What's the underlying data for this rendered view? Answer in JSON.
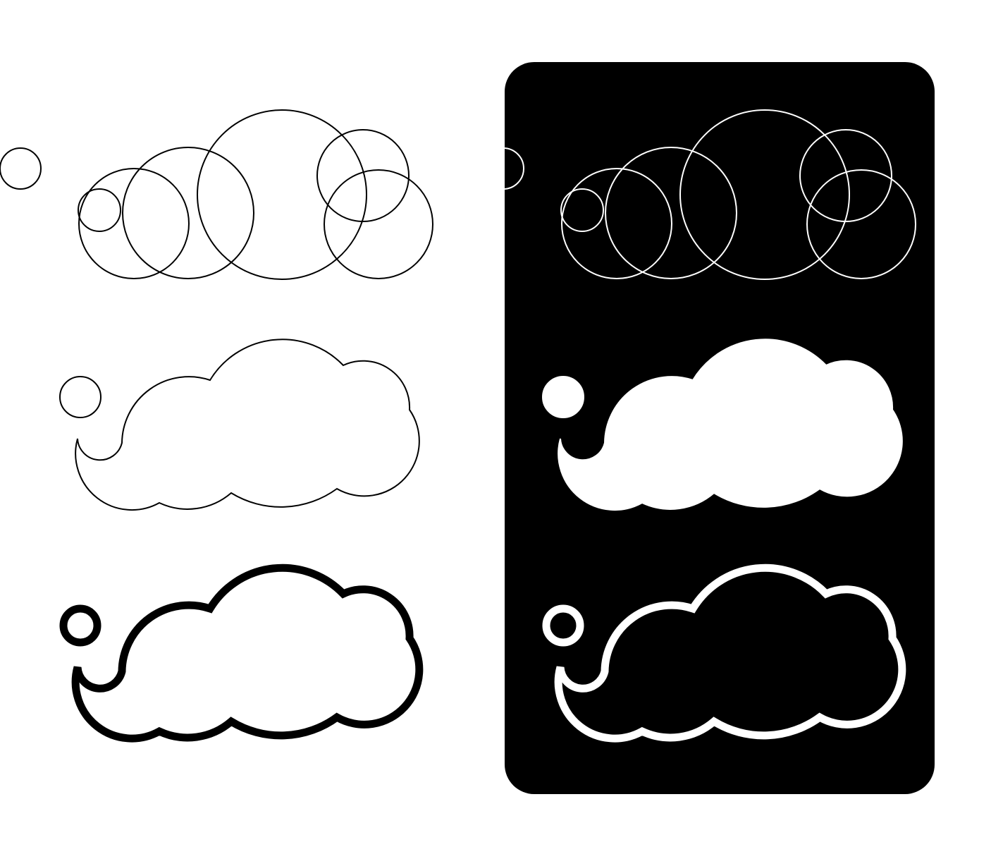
{
  "colors": {
    "page_background": "#ffffff",
    "panel_background": "#000000",
    "ink_on_light": "#000000",
    "ink_on_dark": "#ffffff"
  },
  "variants": [
    {
      "id": "construction-circles",
      "style": "thin-outline"
    },
    {
      "id": "cloud-outline",
      "style": "thin-outline"
    },
    {
      "id": "cloud-bold-outline",
      "style": "thick-outline"
    }
  ],
  "panels": [
    {
      "id": "light-panel",
      "theme": "light"
    },
    {
      "id": "dark-panel",
      "theme": "dark"
    }
  ]
}
